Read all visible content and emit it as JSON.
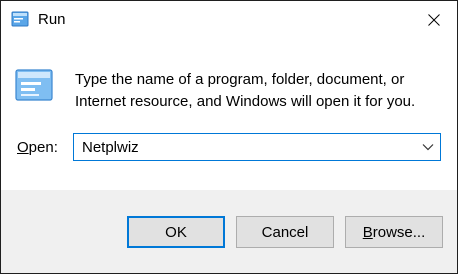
{
  "window": {
    "title": "Run",
    "title_icon": "run-icon",
    "close_icon": "close-icon"
  },
  "content": {
    "icon": "run-program-icon",
    "description_line1": "Type the name of a program, folder, document, or",
    "description_line2": "Internet resource, and Windows will open it for you.",
    "open_label_accel": "O",
    "open_label_rest": "pen:",
    "open_value": "Netplwiz",
    "dropdown_icon": "chevron-down-icon"
  },
  "buttons": {
    "ok_label": "OK",
    "cancel_label": "Cancel",
    "browse_label_accel": "B",
    "browse_label_rest": "rowse..."
  },
  "colors": {
    "accent": "#0078d7",
    "footer_bg": "#f0f0f0",
    "button_bg": "#e1e1e1"
  }
}
